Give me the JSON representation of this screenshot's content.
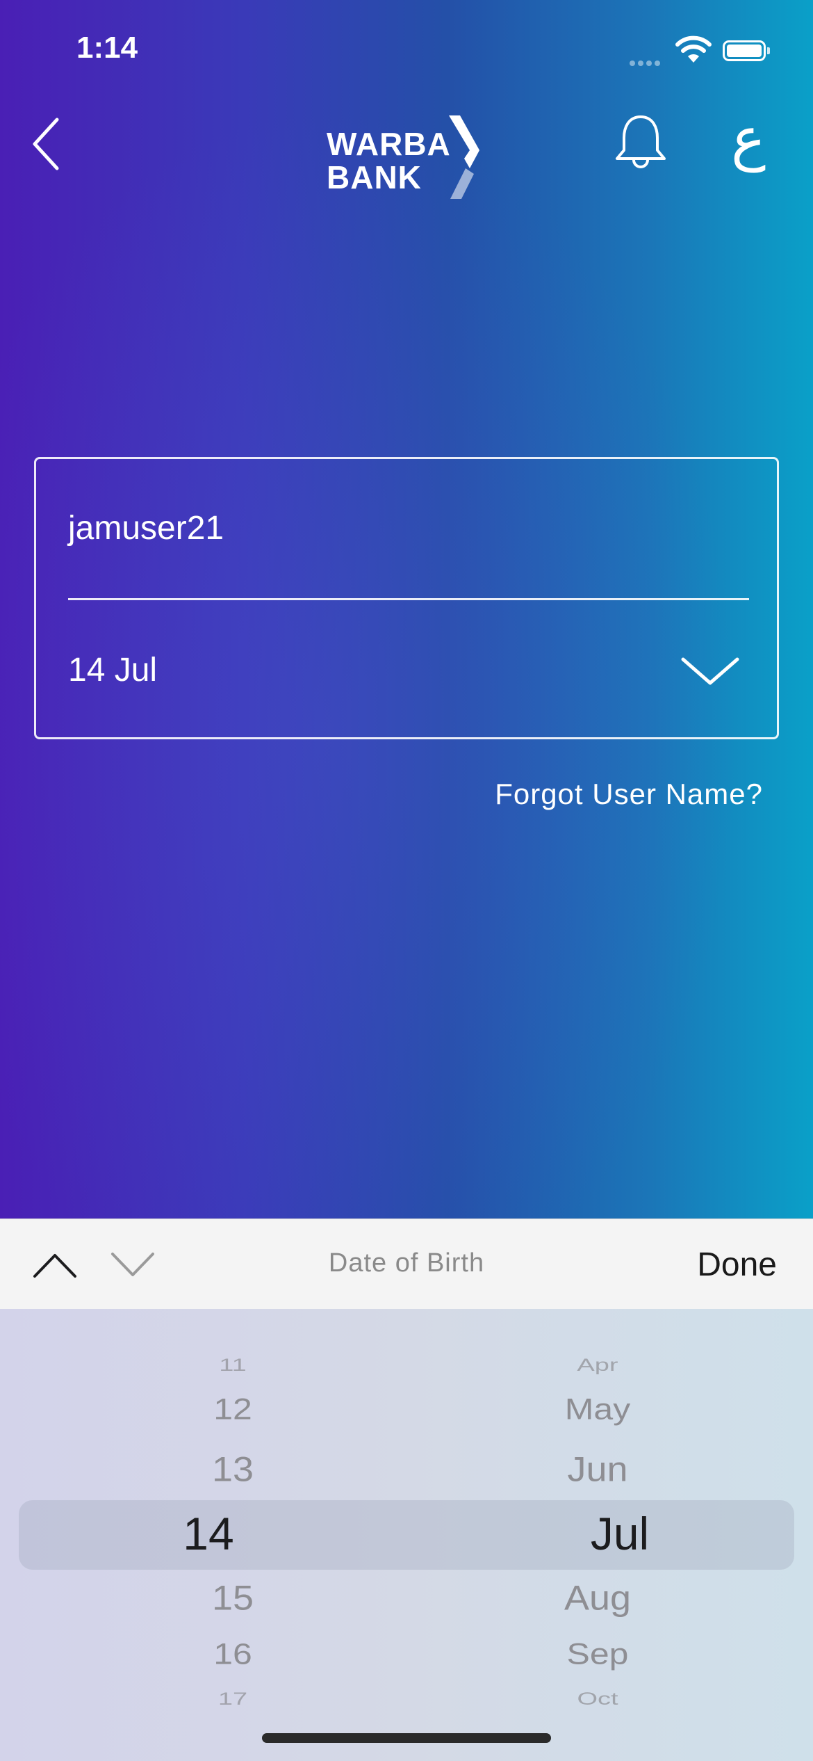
{
  "status_bar": {
    "time": "1:14"
  },
  "header": {
    "logo_line1": "WARBA",
    "logo_line2": "BANK",
    "language_toggle": "ع"
  },
  "form": {
    "username_value": "jamuser21",
    "dob_value": "14 Jul",
    "forgot_link": "Forgot User Name?"
  },
  "picker_toolbar": {
    "title": "Date of Birth",
    "done_label": "Done"
  },
  "picker": {
    "days": [
      "11",
      "12",
      "13",
      "14",
      "15",
      "16",
      "17"
    ],
    "months": [
      "Apr",
      "May",
      "Jun",
      "Jul",
      "Aug",
      "Sep",
      "Oct"
    ],
    "selected_day": "14",
    "selected_month": "Jul"
  }
}
